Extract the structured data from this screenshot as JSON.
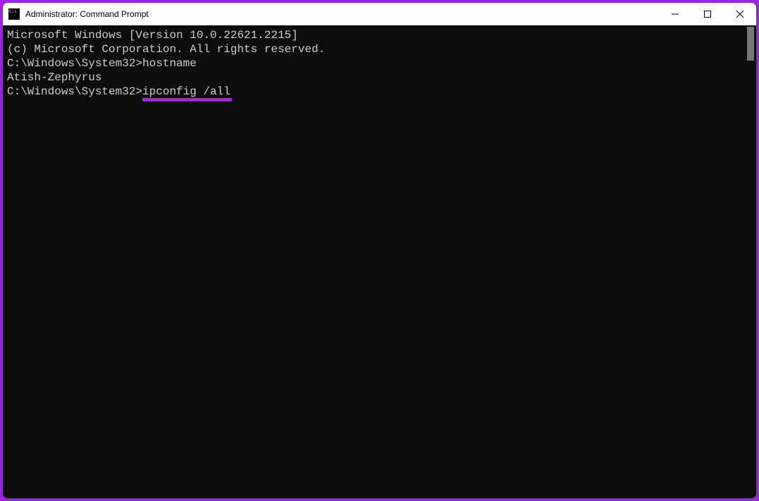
{
  "window": {
    "title": "Administrator: Command Prompt"
  },
  "terminal": {
    "line1": "Microsoft Windows [Version 10.0.22621.2215]",
    "line2": "(c) Microsoft Corporation. All rights reserved.",
    "blank1": "",
    "prompt1_path": "C:\\Windows\\System32>",
    "prompt1_cmd": "hostname",
    "output1": "Atish-Zephyrus",
    "blank2": "",
    "prompt2_path": "C:\\Windows\\System32>",
    "prompt2_cmd": "ipconfig /all"
  },
  "colors": {
    "accent": "#a020f0",
    "terminal_bg": "#0c0c0c",
    "terminal_fg": "#cccccc"
  }
}
